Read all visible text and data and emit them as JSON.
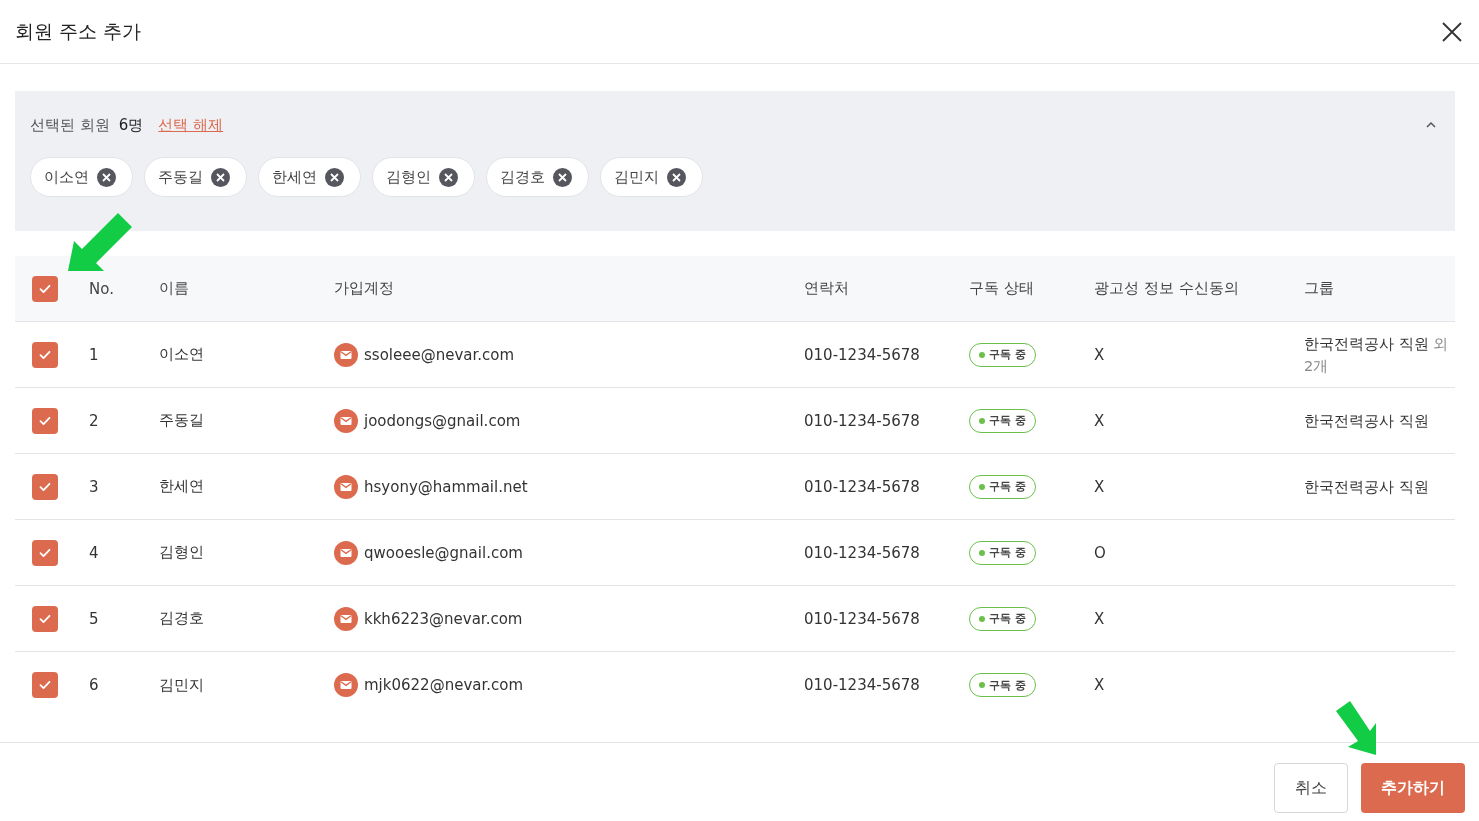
{
  "dialog": {
    "title": "회원 주소 추가"
  },
  "selection": {
    "label": "선택된 회원",
    "count": "6명",
    "clear_link": "선택 해제",
    "expanded": true,
    "chips": [
      "이소연",
      "주동길",
      "한세연",
      "김형인",
      "김경호",
      "김민지"
    ]
  },
  "table": {
    "all_checked": true,
    "columns": [
      "No.",
      "이름",
      "가입계정",
      "연락처",
      "구독 상태",
      "광고성 정보 수신동의",
      "그룹"
    ],
    "rows": [
      {
        "checked": true,
        "no": "1",
        "name": "이소연",
        "email": "ssoleee@nevar.com",
        "phone": "010-1234-5678",
        "status": "구독 중",
        "consent": "X",
        "group": "한국전력공사 직원",
        "group_extra": "외 2개"
      },
      {
        "checked": true,
        "no": "2",
        "name": "주동길",
        "email": "joodongs@gnail.com",
        "phone": "010-1234-5678",
        "status": "구독 중",
        "consent": "X",
        "group": "한국전력공사 직원"
      },
      {
        "checked": true,
        "no": "3",
        "name": "한세연",
        "email": "hsyony@hammail.net",
        "phone": "010-1234-5678",
        "status": "구독 중",
        "consent": "X",
        "group": "한국전력공사 직원"
      },
      {
        "checked": true,
        "no": "4",
        "name": "김형인",
        "email": "qwooesle@gnail.com",
        "phone": "010-1234-5678",
        "status": "구독 중",
        "consent": "O"
      },
      {
        "checked": true,
        "no": "5",
        "name": "김경호",
        "email": "kkh6223@nevar.com",
        "phone": "010-1234-5678",
        "status": "구독 중",
        "consent": "X"
      },
      {
        "checked": true,
        "no": "6",
        "name": "김민지",
        "email": "mjk0622@nevar.com",
        "phone": "010-1234-5678",
        "status": "구독 중",
        "consent": "X"
      }
    ]
  },
  "buttons": [
    {
      "label": "취소",
      "kind": "secondary"
    },
    {
      "label": "추가하기",
      "kind": "primary"
    }
  ]
}
